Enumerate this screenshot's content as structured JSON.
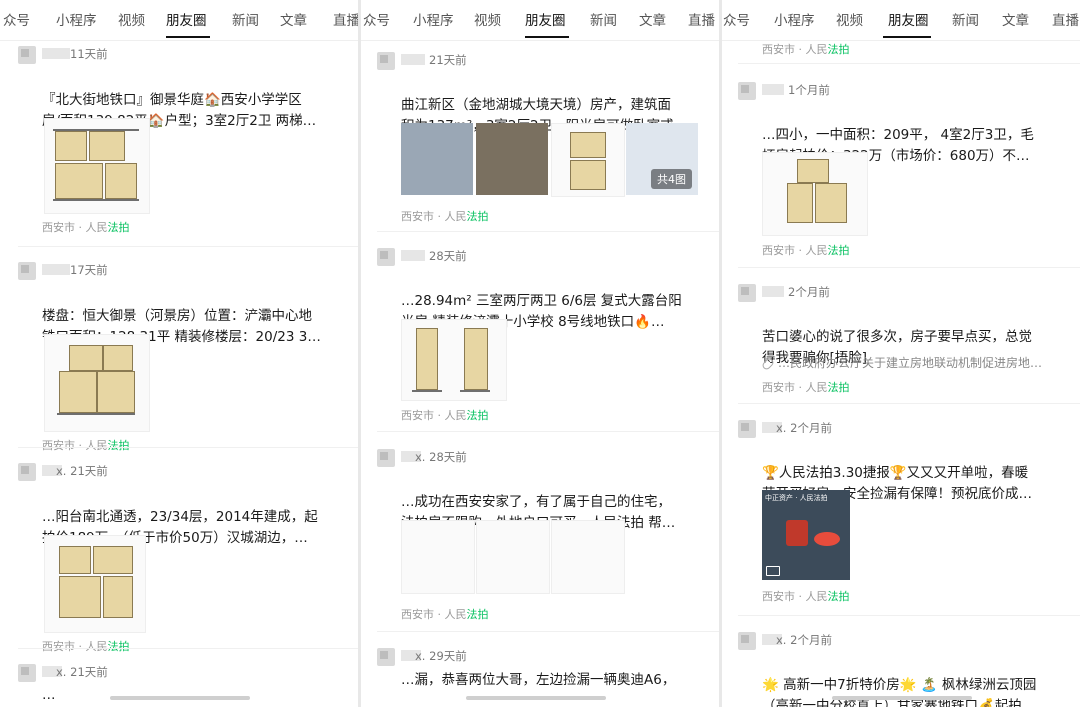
{
  "columns": [
    {
      "tabs": [
        "众号",
        "小程序",
        "视频",
        "朋友圈",
        "新闻",
        "文章",
        "直播"
      ],
      "active_tab": 3,
      "posts": [
        {
          "username": "",
          "time": "11天前",
          "lines": [
            "『北大街地铁口』御景华庭🏠西安小学学区",
            "房/面积139.82平🏠户型；3室2厅2卫 两梯…"
          ],
          "location": "西安市 · 人民",
          "source": "法拍"
        },
        {
          "username": "",
          "time": "17天前",
          "lines": [
            "楼盘：恒大御景（河景房）位置：浐灞中心地",
            "铁口面积：128.31平 精装修楼层：20/23 3…"
          ],
          "location": "西安市 · 人民",
          "source": "法拍"
        },
        {
          "username": "x.",
          "time": "21天前",
          "lines": [
            "…阳台南北通透，23/34层，2014年建成，起",
            "拍价189万，（低于市价50万）汉城湖边，…"
          ],
          "location": "西安市 · 人民",
          "source": "法拍"
        },
        {
          "username": "x.",
          "time": "21天前",
          "lines": [
            "…"
          ],
          "location": "",
          "source": ""
        }
      ]
    },
    {
      "tabs": [
        "众号",
        "小程序",
        "视频",
        "朋友圈",
        "新闻",
        "文章",
        "直播"
      ],
      "active_tab": 3,
      "posts": [
        {
          "username": "",
          "time": "21天前",
          "lines": [
            "曲江新区（金地湖城大境天境）房产，建筑面",
            "积为137m²，3室2厅2卫，阳光房可做卧室或…"
          ],
          "location": "西安市 · 人民",
          "source": "法拍",
          "image_count": "共4图"
        },
        {
          "username": "",
          "time": "28天前",
          "lines": [
            "…28.94m² 三室两厅两卫 6/6层 复式大露台阳",
            "光房 精装修浐灞十小学校 8号线地铁口🔥…"
          ],
          "location": "西安市 · 人民",
          "source": "法拍"
        },
        {
          "username": "x.",
          "time": "28天前",
          "lines": [
            "…成功在西安安家了，有了属于自己的住宅，",
            "法拍房不限购，外地户口可买，人民法拍 帮…"
          ],
          "location": "西安市 · 人民",
          "source": "法拍"
        },
        {
          "username": "x.",
          "time": "29天前",
          "lines": [
            "…漏，恭喜两位大哥，左边捡漏一辆奥迪A6，"
          ],
          "location": "",
          "source": ""
        }
      ]
    },
    {
      "tabs": [
        "众号",
        "小程序",
        "视频",
        "朋友圈",
        "新闻",
        "文章",
        "直播"
      ],
      "active_tab": 3,
      "posts": [
        {
          "username": "",
          "time": "",
          "lines": [],
          "location": "西安市 · 人民",
          "source": "法拍"
        },
        {
          "username": "",
          "time": "1个月前",
          "lines": [
            "…四小，一中面积：209平， 4室2厅3卫，毛",
            "坯房起拍价：322万（市场价：680万）不…"
          ],
          "location": "西安市 · 人民",
          "source": "法拍"
        },
        {
          "username": "",
          "time": "2个月前",
          "lines": [
            "苦口婆心的说了很多次，房子要早点买，总觉",
            "得我要骗你[捂脸]"
          ],
          "link": "…民政府办公厅关于建立房地联动机制促进房地…",
          "location": "西安市 · 人民",
          "source": "法拍"
        },
        {
          "username": "x.",
          "time": "2个月前",
          "lines": [
            "🏆人民法拍3.30捷报🏆又又又开单啦，春暖",
            "花开买好房，安全捡漏有保障！预祝底价成…"
          ],
          "video_label": "中正资产 · 人民法拍",
          "location": "西安市 · 人民",
          "source": "法拍"
        },
        {
          "username": "x.",
          "time": "2个月前",
          "lines": [
            "🌟 高新一中7折特价房🌟 🏝️ 枫林绿洲云顶园",
            "（高新一中分校直上）甘家寨地铁口💰起拍…"
          ],
          "location": "",
          "source": ""
        }
      ]
    }
  ],
  "colors": {
    "accent_link": "#576b95",
    "brand_green": "#07c160"
  }
}
